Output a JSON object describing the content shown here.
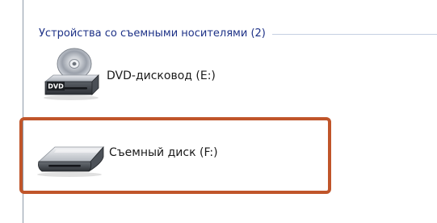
{
  "group": {
    "title": "Устройства со съемными носителями (2)"
  },
  "devices": [
    {
      "label": "DVD-дисковод (E:)",
      "icon": "dvd-drive-icon",
      "icon_text": "DVD"
    },
    {
      "label": "Съемный диск (F:)",
      "icon": "removable-disk-icon"
    }
  ],
  "colors": {
    "group_title": "#1e3287",
    "highlight_border": "#c0552a"
  }
}
